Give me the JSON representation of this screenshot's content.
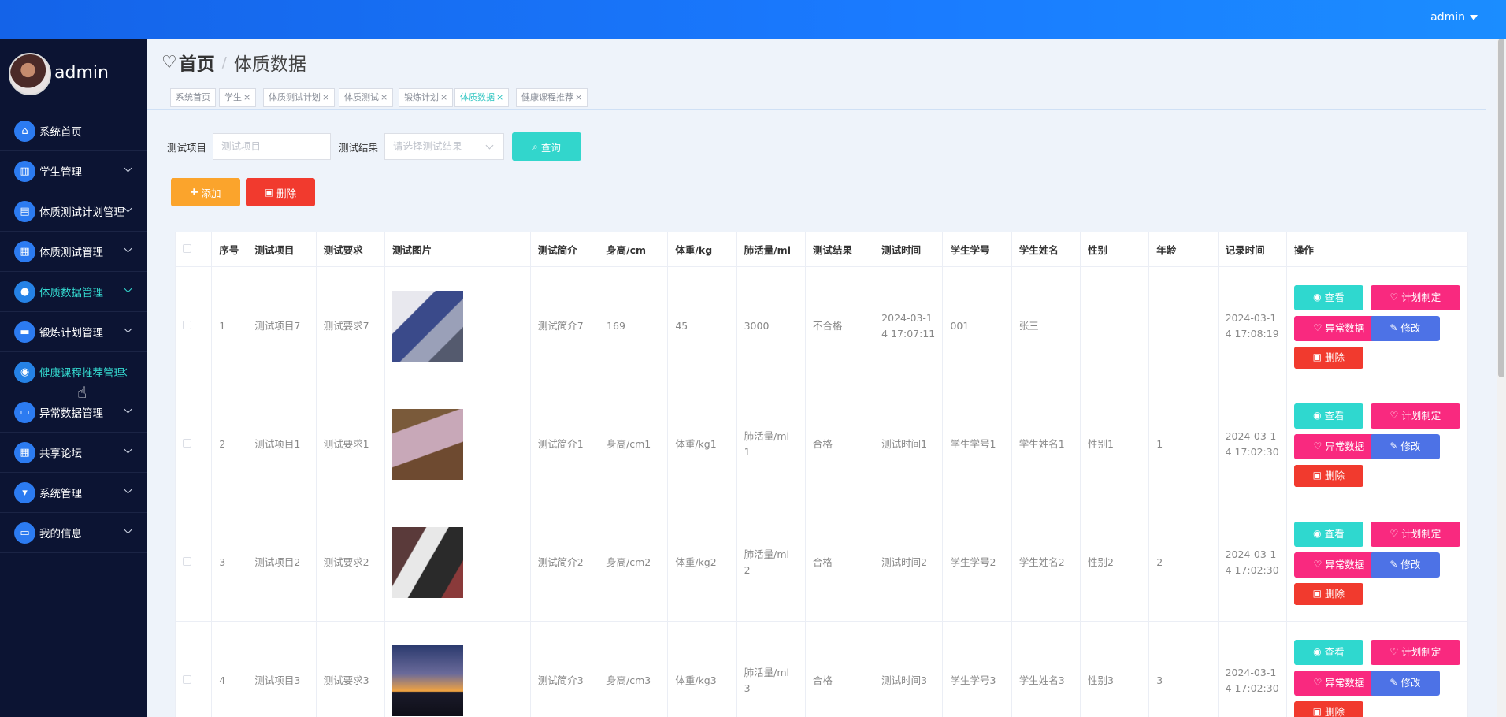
{
  "topbar": {
    "user": "admin"
  },
  "sidebar": {
    "username": "admin",
    "items": [
      {
        "label": "系统首页",
        "icon": "home-icon",
        "glyph": "⌂"
      },
      {
        "label": "学生管理",
        "icon": "book-icon",
        "glyph": "▥"
      },
      {
        "label": "体质测试计划管理",
        "icon": "clipboard-icon",
        "glyph": "▤"
      },
      {
        "label": "体质测试管理",
        "icon": "grid-icon",
        "glyph": "▦"
      },
      {
        "label": "体质数据管理",
        "icon": "location-icon",
        "glyph": "●"
      },
      {
        "label": "锻炼计划管理",
        "icon": "monitor-icon",
        "glyph": "▬"
      },
      {
        "label": "健康课程推荐管理",
        "icon": "person-icon",
        "glyph": "◉"
      },
      {
        "label": "异常数据管理",
        "icon": "chat-icon",
        "glyph": "▭"
      },
      {
        "label": "共享论坛",
        "icon": "grid-icon",
        "glyph": "▦"
      },
      {
        "label": "系统管理",
        "icon": "settings-icon",
        "glyph": "▾"
      },
      {
        "label": "我的信息",
        "icon": "card-icon",
        "glyph": "▭"
      }
    ]
  },
  "breadcrumb": {
    "home": "首页",
    "current": "体质数据"
  },
  "tags": [
    "系统首页",
    "学生",
    "体质测试计划",
    "体质测试",
    "锻炼计划",
    "体质数据",
    "健康课程推荐"
  ],
  "search": {
    "label1": "测试项目",
    "placeholder1": "测试项目",
    "label2": "测试结果",
    "placeholder2": "请选择测试结果",
    "query": "查询"
  },
  "actions": {
    "add": "添加",
    "delete": "删除"
  },
  "table": {
    "headers": [
      "序号",
      "测试项目",
      "测试要求",
      "测试图片",
      "测试简介",
      "身高/cm",
      "体重/kg",
      "肺活量/ml",
      "测试结果",
      "测试时间",
      "学生学号",
      "学生姓名",
      "性别",
      "年龄",
      "记录时间",
      "操作"
    ],
    "rows": [
      {
        "no": "1",
        "item": "测试项目7",
        "req": "测试要求7",
        "intro": "测试简介7",
        "height": "169",
        "weight": "45",
        "lung": "3000",
        "result": "不合格",
        "time": "2024-03-1\n4 17:07:11",
        "sid": "001",
        "sname": "张三",
        "gender": "",
        "age": "",
        "rtime": "2024-03-1\n4 17:08:19"
      },
      {
        "no": "2",
        "item": "测试项目1",
        "req": "测试要求1",
        "intro": "测试简介1",
        "height": "身高/cm1",
        "weight": "体重/kg1",
        "lung": "肺活量/ml\n1",
        "result": "合格",
        "time": "测试时间1",
        "sid": "学生学号1",
        "sname": "学生姓名1",
        "gender": "性别1",
        "age": "1",
        "rtime": "2024-03-1\n4 17:02:30"
      },
      {
        "no": "3",
        "item": "测试项目2",
        "req": "测试要求2",
        "intro": "测试简介2",
        "height": "身高/cm2",
        "weight": "体重/kg2",
        "lung": "肺活量/ml\n2",
        "result": "合格",
        "time": "测试时间2",
        "sid": "学生学号2",
        "sname": "学生姓名2",
        "gender": "性别2",
        "age": "2",
        "rtime": "2024-03-1\n4 17:02:30"
      },
      {
        "no": "4",
        "item": "测试项目3",
        "req": "测试要求3",
        "intro": "测试简介3",
        "height": "身高/cm3",
        "weight": "体重/kg3",
        "lung": "肺活量/ml\n3",
        "result": "合格",
        "time": "测试时间3",
        "sid": "学生学号3",
        "sname": "学生姓名3",
        "gender": "性别3",
        "age": "3",
        "rtime": "2024-03-1\n4 17:02:30"
      }
    ],
    "ops": {
      "view": "查看",
      "plan": "计划制定",
      "abnormal": "异常数据",
      "edit": "修改",
      "remove": "删除"
    }
  },
  "colors": {
    "topbar": "#1a7bff",
    "sidebar": "#0c1433",
    "active": "#34d8cf",
    "pink": "#f9297f",
    "red": "#f13a2e",
    "orange": "#fba42c",
    "teal": "#32d6cc"
  }
}
